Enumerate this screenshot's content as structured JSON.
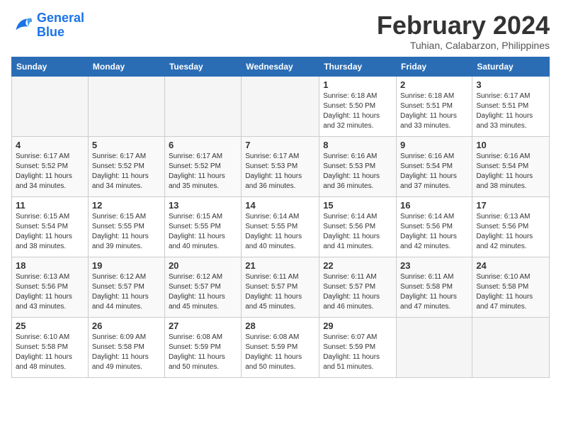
{
  "header": {
    "logo_line1": "General",
    "logo_line2": "Blue",
    "month_title": "February 2024",
    "location": "Tuhian, Calabarzon, Philippines"
  },
  "days_of_week": [
    "Sunday",
    "Monday",
    "Tuesday",
    "Wednesday",
    "Thursday",
    "Friday",
    "Saturday"
  ],
  "weeks": [
    [
      {
        "day": "",
        "content": ""
      },
      {
        "day": "",
        "content": ""
      },
      {
        "day": "",
        "content": ""
      },
      {
        "day": "",
        "content": ""
      },
      {
        "day": "1",
        "content": "Sunrise: 6:18 AM\nSunset: 5:50 PM\nDaylight: 11 hours\nand 32 minutes."
      },
      {
        "day": "2",
        "content": "Sunrise: 6:18 AM\nSunset: 5:51 PM\nDaylight: 11 hours\nand 33 minutes."
      },
      {
        "day": "3",
        "content": "Sunrise: 6:17 AM\nSunset: 5:51 PM\nDaylight: 11 hours\nand 33 minutes."
      }
    ],
    [
      {
        "day": "4",
        "content": "Sunrise: 6:17 AM\nSunset: 5:52 PM\nDaylight: 11 hours\nand 34 minutes."
      },
      {
        "day": "5",
        "content": "Sunrise: 6:17 AM\nSunset: 5:52 PM\nDaylight: 11 hours\nand 34 minutes."
      },
      {
        "day": "6",
        "content": "Sunrise: 6:17 AM\nSunset: 5:52 PM\nDaylight: 11 hours\nand 35 minutes."
      },
      {
        "day": "7",
        "content": "Sunrise: 6:17 AM\nSunset: 5:53 PM\nDaylight: 11 hours\nand 36 minutes."
      },
      {
        "day": "8",
        "content": "Sunrise: 6:16 AM\nSunset: 5:53 PM\nDaylight: 11 hours\nand 36 minutes."
      },
      {
        "day": "9",
        "content": "Sunrise: 6:16 AM\nSunset: 5:54 PM\nDaylight: 11 hours\nand 37 minutes."
      },
      {
        "day": "10",
        "content": "Sunrise: 6:16 AM\nSunset: 5:54 PM\nDaylight: 11 hours\nand 38 minutes."
      }
    ],
    [
      {
        "day": "11",
        "content": "Sunrise: 6:15 AM\nSunset: 5:54 PM\nDaylight: 11 hours\nand 38 minutes."
      },
      {
        "day": "12",
        "content": "Sunrise: 6:15 AM\nSunset: 5:55 PM\nDaylight: 11 hours\nand 39 minutes."
      },
      {
        "day": "13",
        "content": "Sunrise: 6:15 AM\nSunset: 5:55 PM\nDaylight: 11 hours\nand 40 minutes."
      },
      {
        "day": "14",
        "content": "Sunrise: 6:14 AM\nSunset: 5:55 PM\nDaylight: 11 hours\nand 40 minutes."
      },
      {
        "day": "15",
        "content": "Sunrise: 6:14 AM\nSunset: 5:56 PM\nDaylight: 11 hours\nand 41 minutes."
      },
      {
        "day": "16",
        "content": "Sunrise: 6:14 AM\nSunset: 5:56 PM\nDaylight: 11 hours\nand 42 minutes."
      },
      {
        "day": "17",
        "content": "Sunrise: 6:13 AM\nSunset: 5:56 PM\nDaylight: 11 hours\nand 42 minutes."
      }
    ],
    [
      {
        "day": "18",
        "content": "Sunrise: 6:13 AM\nSunset: 5:56 PM\nDaylight: 11 hours\nand 43 minutes."
      },
      {
        "day": "19",
        "content": "Sunrise: 6:12 AM\nSunset: 5:57 PM\nDaylight: 11 hours\nand 44 minutes."
      },
      {
        "day": "20",
        "content": "Sunrise: 6:12 AM\nSunset: 5:57 PM\nDaylight: 11 hours\nand 45 minutes."
      },
      {
        "day": "21",
        "content": "Sunrise: 6:11 AM\nSunset: 5:57 PM\nDaylight: 11 hours\nand 45 minutes."
      },
      {
        "day": "22",
        "content": "Sunrise: 6:11 AM\nSunset: 5:57 PM\nDaylight: 11 hours\nand 46 minutes."
      },
      {
        "day": "23",
        "content": "Sunrise: 6:11 AM\nSunset: 5:58 PM\nDaylight: 11 hours\nand 47 minutes."
      },
      {
        "day": "24",
        "content": "Sunrise: 6:10 AM\nSunset: 5:58 PM\nDaylight: 11 hours\nand 47 minutes."
      }
    ],
    [
      {
        "day": "25",
        "content": "Sunrise: 6:10 AM\nSunset: 5:58 PM\nDaylight: 11 hours\nand 48 minutes."
      },
      {
        "day": "26",
        "content": "Sunrise: 6:09 AM\nSunset: 5:58 PM\nDaylight: 11 hours\nand 49 minutes."
      },
      {
        "day": "27",
        "content": "Sunrise: 6:08 AM\nSunset: 5:59 PM\nDaylight: 11 hours\nand 50 minutes."
      },
      {
        "day": "28",
        "content": "Sunrise: 6:08 AM\nSunset: 5:59 PM\nDaylight: 11 hours\nand 50 minutes."
      },
      {
        "day": "29",
        "content": "Sunrise: 6:07 AM\nSunset: 5:59 PM\nDaylight: 11 hours\nand 51 minutes."
      },
      {
        "day": "",
        "content": ""
      },
      {
        "day": "",
        "content": ""
      }
    ]
  ]
}
